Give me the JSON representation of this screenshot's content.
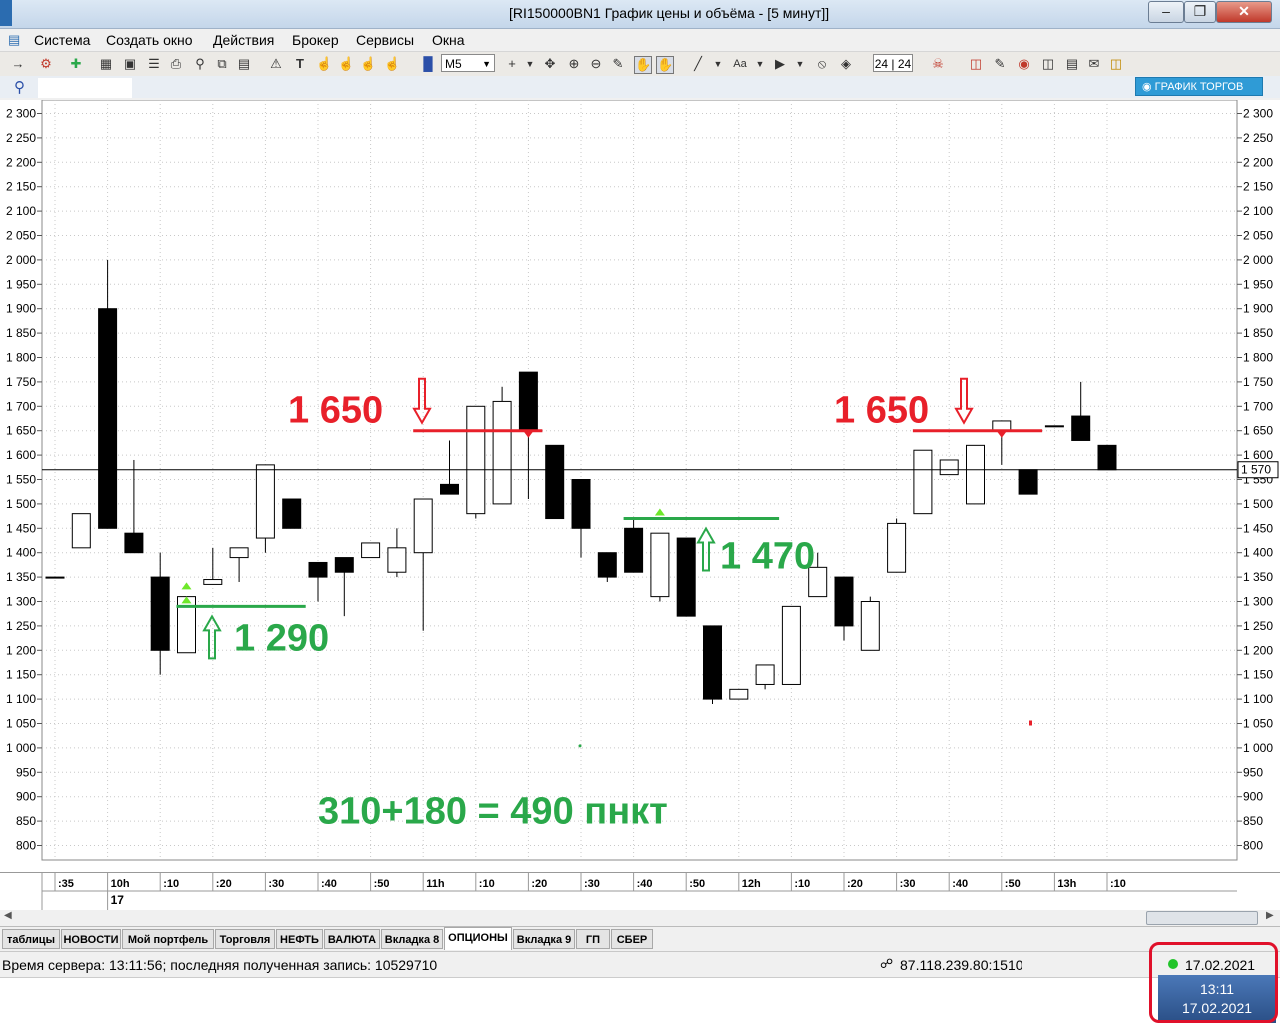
{
  "window": {
    "title": "[RI150000BN1 График цены и объёма - [5 минут]]"
  },
  "menu": [
    "Система",
    "Создать окно",
    "Действия",
    "Брокер",
    "Сервисы",
    "Окна"
  ],
  "toolbar": {
    "timeframe": "M5",
    "zoom": "24 | 24",
    "trade_chart_label": "ГРАФИК ТОРГОВ"
  },
  "tabs": [
    {
      "label": "таблицы",
      "active": false
    },
    {
      "label": "НОВОСТИ",
      "active": false
    },
    {
      "label": "Мой портфель",
      "active": false
    },
    {
      "label": "Торговля",
      "active": false
    },
    {
      "label": "НЕФТЬ",
      "active": false
    },
    {
      "label": "ВАЛЮТА",
      "active": false
    },
    {
      "label": "Вкладка 8",
      "active": false
    },
    {
      "label": "ОПЦИОНЫ",
      "active": true
    },
    {
      "label": "Вкладка 9",
      "active": false
    },
    {
      "label": "ГП",
      "active": false
    },
    {
      "label": "СБЕР",
      "active": false
    }
  ],
  "status": {
    "server_time": "Время сервера: 13:11:56; последняя полученная запись: 10529710",
    "connection": "87.118.239.80:1510",
    "date": "17.02.2021"
  },
  "taskbar": {
    "time": "13:11",
    "date": "17.02.2021"
  },
  "colors": {
    "up_candle": "#ffffff",
    "down_candle": "#000000",
    "annotation_red": "#e8202a",
    "annotation_green": "#2aa84a",
    "signal_green": "#6ee82a"
  },
  "chart_data": {
    "type": "candlestick",
    "instrument": "RI150000BN1",
    "timeframe": "5 минут",
    "y_ticks": [
      "2 300",
      "2 250",
      "2 200",
      "2 150",
      "2 100",
      "2 050",
      "2 000",
      "1 950",
      "1 900",
      "1 850",
      "1 800",
      "1 750",
      "1 700",
      "1 650",
      "1 600",
      "1 550",
      "1 500",
      "1 450",
      "1 400",
      "1 350",
      "1 300",
      "1 250",
      "1 200",
      "1 150",
      "1 100",
      "1 050",
      "1 000",
      "950",
      "900",
      "850",
      "800"
    ],
    "ylim": [
      780,
      2320
    ],
    "current_price": 1570,
    "current_price_label": "1 570",
    "x_ticks": [
      ":35",
      "10h",
      ":10",
      ":20",
      ":30",
      ":40",
      ":50",
      "11h",
      ":10",
      ":20",
      ":30",
      ":40",
      ":50",
      "12h",
      ":10",
      ":20",
      ":30",
      ":40",
      ":50",
      "13h",
      ":10"
    ],
    "date_label": "17",
    "candles": [
      {
        "t": "09:35",
        "o": 1350,
        "h": 1350,
        "l": 1350,
        "c": 1350
      },
      {
        "t": "09:40",
        "o": 1410,
        "h": 1480,
        "l": 1410,
        "c": 1480
      },
      {
        "t": "09:45",
        "o": 1900,
        "h": 2000,
        "l": 1450,
        "c": 1450
      },
      {
        "t": "09:50",
        "o": 1440,
        "h": 1590,
        "l": 1400,
        "c": 1400
      },
      {
        "t": "09:55",
        "o": 1350,
        "h": 1400,
        "l": 1150,
        "c": 1200
      },
      {
        "t": "10:00",
        "o": 1195,
        "h": 1310,
        "l": 1195,
        "c": 1310
      },
      {
        "t": "10:05",
        "o": 1335,
        "h": 1410,
        "l": 1335,
        "c": 1345
      },
      {
        "t": "10:10",
        "o": 1390,
        "h": 1400,
        "l": 1340,
        "c": 1410
      },
      {
        "t": "10:15",
        "o": 1430,
        "h": 1580,
        "l": 1400,
        "c": 1580
      },
      {
        "t": "10:20",
        "o": 1510,
        "h": 1510,
        "l": 1450,
        "c": 1450
      },
      {
        "t": "10:25",
        "o": 1380,
        "h": 1380,
        "l": 1300,
        "c": 1350
      },
      {
        "t": "10:30",
        "o": 1390,
        "h": 1390,
        "l": 1270,
        "c": 1360
      },
      {
        "t": "10:35",
        "o": 1390,
        "h": 1420,
        "l": 1390,
        "c": 1420
      },
      {
        "t": "10:40",
        "o": 1360,
        "h": 1450,
        "l": 1350,
        "c": 1410
      },
      {
        "t": "10:45",
        "o": 1400,
        "h": 1510,
        "l": 1240,
        "c": 1510
      },
      {
        "t": "10:50",
        "o": 1540,
        "h": 1630,
        "l": 1520,
        "c": 1520
      },
      {
        "t": "10:55",
        "o": 1480,
        "h": 1700,
        "l": 1470,
        "c": 1700
      },
      {
        "t": "11:00",
        "o": 1500,
        "h": 1740,
        "l": 1500,
        "c": 1710
      },
      {
        "t": "11:05",
        "o": 1770,
        "h": 1770,
        "l": 1510,
        "c": 1650
      },
      {
        "t": "11:10",
        "o": 1620,
        "h": 1620,
        "l": 1470,
        "c": 1470
      },
      {
        "t": "11:15",
        "o": 1550,
        "h": 1550,
        "l": 1390,
        "c": 1450
      },
      {
        "t": "11:20",
        "o": 1400,
        "h": 1400,
        "l": 1340,
        "c": 1350
      },
      {
        "t": "11:25",
        "o": 1450,
        "h": 1470,
        "l": 1360,
        "c": 1360
      },
      {
        "t": "11:30",
        "o": 1310,
        "h": 1440,
        "l": 1300,
        "c": 1440
      },
      {
        "t": "11:35",
        "o": 1430,
        "h": 1430,
        "l": 1270,
        "c": 1270
      },
      {
        "t": "11:40",
        "o": 1250,
        "h": 1250,
        "l": 1090,
        "c": 1100
      },
      {
        "t": "11:45",
        "o": 1100,
        "h": 1120,
        "l": 1100,
        "c": 1120
      },
      {
        "t": "11:50",
        "o": 1130,
        "h": 1170,
        "l": 1120,
        "c": 1170
      },
      {
        "t": "11:55",
        "o": 1130,
        "h": 1290,
        "l": 1130,
        "c": 1290
      },
      {
        "t": "12:00",
        "o": 1310,
        "h": 1400,
        "l": 1310,
        "c": 1370
      },
      {
        "t": "12:05",
        "o": 1350,
        "h": 1350,
        "l": 1220,
        "c": 1250
      },
      {
        "t": "12:10",
        "o": 1200,
        "h": 1310,
        "l": 1200,
        "c": 1300
      },
      {
        "t": "12:15",
        "o": 1360,
        "h": 1470,
        "l": 1360,
        "c": 1460
      },
      {
        "t": "12:20",
        "o": 1480,
        "h": 1610,
        "l": 1480,
        "c": 1610
      },
      {
        "t": "12:25",
        "o": 1560,
        "h": 1590,
        "l": 1560,
        "c": 1590
      },
      {
        "t": "12:30",
        "o": 1500,
        "h": 1620,
        "l": 1500,
        "c": 1620
      },
      {
        "t": "12:35",
        "o": 1650,
        "h": 1670,
        "l": 1580,
        "c": 1670
      },
      {
        "t": "12:40",
        "o": 1570,
        "h": 1570,
        "l": 1520,
        "c": 1520
      },
      {
        "t": "12:45",
        "o": 1660,
        "h": 1660,
        "l": 1660,
        "c": 1660
      },
      {
        "t": "12:50",
        "o": 1680,
        "h": 1750,
        "l": 1630,
        "c": 1630
      },
      {
        "t": "12:55",
        "o": 1620,
        "h": 1620,
        "l": 1570,
        "c": 1570
      }
    ],
    "annotations": [
      {
        "text": "1 650",
        "color": "red",
        "level": 1650,
        "from": "10:45",
        "to": "11:05"
      },
      {
        "text": "1 650",
        "color": "red",
        "level": 1650,
        "from": "12:20",
        "to": "12:40"
      },
      {
        "text": "1 290",
        "color": "green",
        "level": 1290,
        "from": "10:00",
        "to": "10:20"
      },
      {
        "text": "1 470",
        "color": "green",
        "level": 1470,
        "from": "11:25",
        "to": "11:50"
      },
      {
        "text": "310+180 = 490 пнкт",
        "color": "green"
      }
    ]
  }
}
